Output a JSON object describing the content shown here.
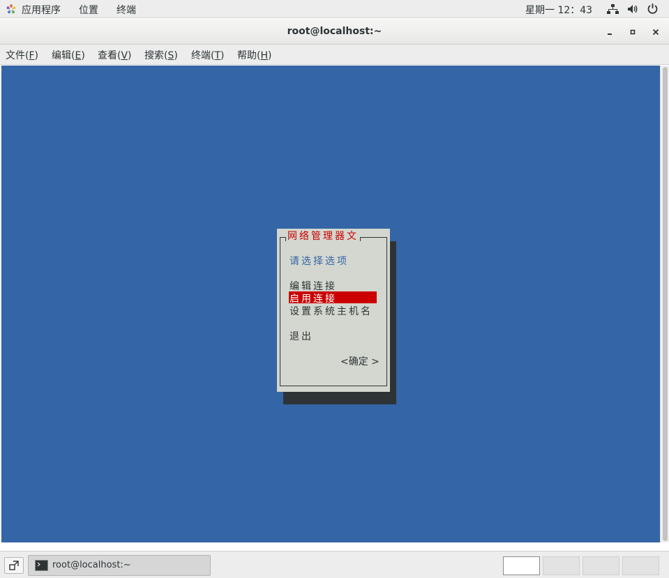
{
  "top_panel": {
    "applications": "应用程序",
    "places": "位置",
    "terminal": "终端",
    "clock": "星期一 12：43"
  },
  "window": {
    "title": "root@localhost:~"
  },
  "menubar": {
    "items": [
      {
        "label": "文件(",
        "mnemonic": "F",
        "tail": ")"
      },
      {
        "label": "编辑(",
        "mnemonic": "E",
        "tail": ")"
      },
      {
        "label": "查看(",
        "mnemonic": "V",
        "tail": ")"
      },
      {
        "label": "搜索(",
        "mnemonic": "S",
        "tail": ")"
      },
      {
        "label": "终端(",
        "mnemonic": "T",
        "tail": ")"
      },
      {
        "label": "帮助(",
        "mnemonic": "H",
        "tail": ")"
      }
    ]
  },
  "dialog": {
    "title": "网络管理器文",
    "prompt": "请选择选项",
    "options": {
      "edit": "编辑连接",
      "activate": "启用连接",
      "hostname": "设置系统主机名",
      "quit": "退出"
    },
    "selected_option": "启用连接",
    "ok_button": "<确定 >"
  },
  "taskbar": {
    "task_label": "root@localhost:~",
    "workspaces": 4,
    "active_workspace": 1
  },
  "colors": {
    "terminal_bg": "#3465a6",
    "dialog_bg": "#d3d7cf",
    "highlight": "#cc0000",
    "prompt_text": "#3465a6"
  }
}
